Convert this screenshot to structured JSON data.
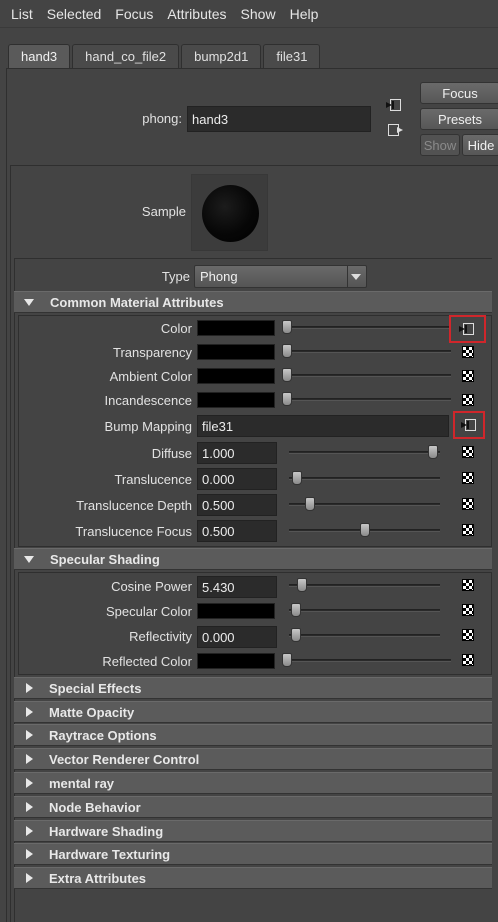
{
  "menu": [
    "List",
    "Selected",
    "Focus",
    "Attributes",
    "Show",
    "Help"
  ],
  "tabs": [
    "hand3",
    "hand_co_file2",
    "bump2d1",
    "file31"
  ],
  "header": {
    "node_type_label": "phong:",
    "node_name": "hand3",
    "focus": "Focus",
    "presets": "Presets",
    "show": "Show",
    "hide": "Hide"
  },
  "sample_label": "Sample",
  "type_label": "Type",
  "type_value": "Phong",
  "common": {
    "title": "Common Material Attributes",
    "color": "Color",
    "transparency": "Transparency",
    "ambient": "Ambient Color",
    "incandescence": "Incandescence",
    "bump": "Bump Mapping",
    "bump_value": "file31",
    "diffuse": "Diffuse",
    "diffuse_value": "1.000",
    "translucence": "Translucence",
    "translucence_value": "0.000",
    "trans_depth": "Translucence Depth",
    "trans_depth_value": "0.500",
    "trans_focus": "Translucence Focus",
    "trans_focus_value": "0.500"
  },
  "specular": {
    "title": "Specular Shading",
    "cosine": "Cosine Power",
    "cosine_value": "5.430",
    "spec_color": "Specular Color",
    "reflectivity": "Reflectivity",
    "reflectivity_value": "0.000",
    "reflected": "Reflected Color"
  },
  "collapsed_sections": [
    "Special Effects",
    "Matte Opacity",
    "Raytrace Options",
    "Vector Renderer Control",
    "mental ray",
    "Node Behavior",
    "Hardware Shading",
    "Hardware Texturing",
    "Extra Attributes"
  ]
}
